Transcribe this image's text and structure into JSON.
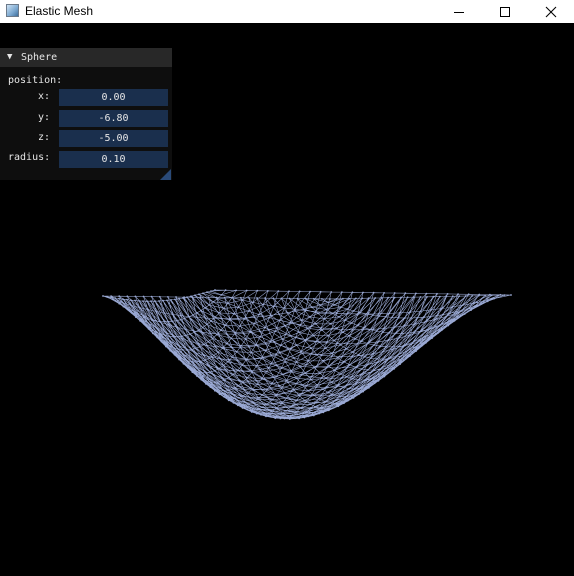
{
  "window": {
    "title": "Elastic Mesh"
  },
  "panel": {
    "title": "Sphere",
    "position_label": "position:",
    "fields": [
      {
        "label": "x:",
        "value": "0.00"
      },
      {
        "label": "y:",
        "value": "-6.80"
      },
      {
        "label": "z:",
        "value": "-5.00"
      }
    ],
    "radius": {
      "label": "radius:",
      "value": "0.10"
    }
  },
  "mesh": {
    "color": "#9aa9d4"
  }
}
